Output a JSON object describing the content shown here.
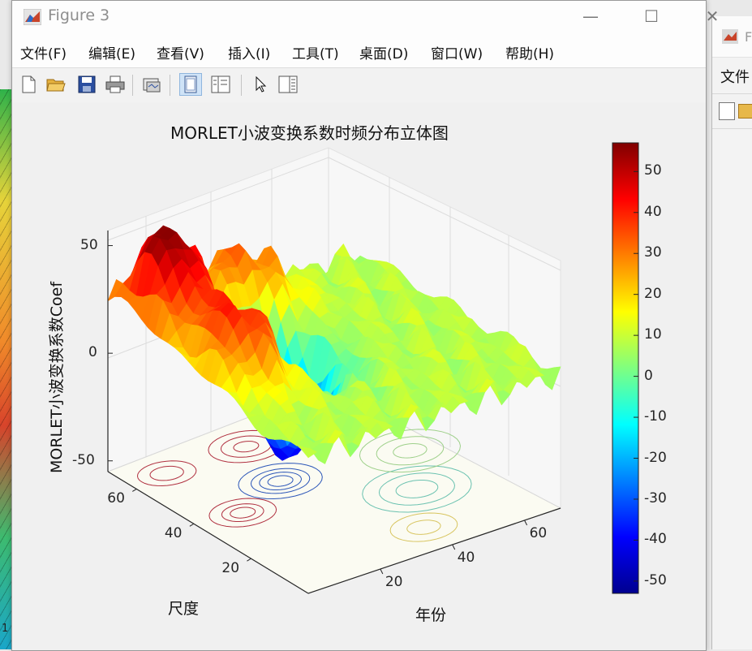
{
  "window": {
    "title": "Figure 3",
    "menu": [
      "文件(F)",
      "编辑(E)",
      "查看(V)",
      "插入(I)",
      "工具(T)",
      "桌面(D)",
      "窗口(W)",
      "帮助(H)"
    ],
    "toolbar_icons": [
      "new-figure-icon",
      "open-file-icon",
      "save-icon",
      "print-icon",
      "link-plot-icon",
      "hide-plot-tools-icon",
      "show-plot-tools-icon",
      "edit-plot-arrow-icon",
      "insert-colorbar-icon"
    ]
  },
  "background_windows": {
    "right": {
      "title": "F",
      "menu_first": "文件"
    },
    "left": {
      "label": "1"
    }
  },
  "chart_data": {
    "type": "surface",
    "title": "MORLET小波变换系数时频分布立体图",
    "xlabel": "年份",
    "ylabel": "尺度",
    "zlabel": "MORLET小波变换系数Coef",
    "x_ticks": [
      20,
      40,
      60
    ],
    "y_ticks": [
      20,
      40,
      60
    ],
    "z_ticks": [
      -50,
      0,
      50
    ],
    "zlim": [
      -55,
      57
    ],
    "colormap": "jet",
    "colorbar": {
      "ticks": [
        50,
        40,
        30,
        20,
        10,
        0,
        -10,
        -20,
        -30,
        -40,
        -50
      ],
      "range": [
        -53,
        57
      ],
      "placement": "right"
    },
    "features": [
      {
        "label": "peak",
        "x": 10,
        "y": 62,
        "z": 57
      },
      {
        "label": "peak",
        "x": 32,
        "y": 62,
        "z": 40
      },
      {
        "label": "peak",
        "x": 12,
        "y": 38,
        "z": 43
      },
      {
        "label": "trough",
        "x": 28,
        "y": 45,
        "z": -52
      }
    ],
    "contour_projection": true,
    "grid": true
  }
}
